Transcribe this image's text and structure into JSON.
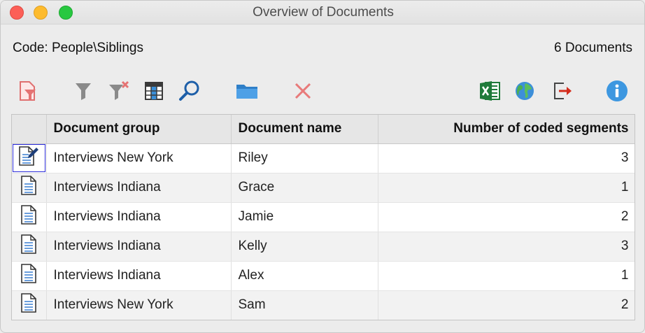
{
  "window": {
    "title": "Overview of Documents"
  },
  "header": {
    "code_label": "Code: People\\Siblings",
    "doc_count": "6 Documents"
  },
  "toolbar": {
    "icons": [
      "filter-document-icon",
      "funnel-icon",
      "funnel-clear-icon",
      "columns-icon",
      "search-icon",
      "folder-icon",
      "delete-icon",
      "excel-icon",
      "globe-icon",
      "export-icon",
      "info-icon"
    ]
  },
  "table": {
    "columns": [
      "Document group",
      "Document name",
      "Number of coded segments"
    ],
    "rows": [
      {
        "group": "Interviews New York",
        "name": "Riley",
        "segments": "3"
      },
      {
        "group": "Interviews Indiana",
        "name": "Grace",
        "segments": "1"
      },
      {
        "group": "Interviews Indiana",
        "name": "Jamie",
        "segments": "2"
      },
      {
        "group": "Interviews Indiana",
        "name": "Kelly",
        "segments": "3"
      },
      {
        "group": "Interviews Indiana",
        "name": "Alex",
        "segments": "1"
      },
      {
        "group": "Interviews New York",
        "name": "Sam",
        "segments": "2"
      }
    ]
  },
  "colors": {
    "accent_blue": "#2d8bd8",
    "excel_green": "#1f7a3a",
    "delete_red": "#e86d6d",
    "export_red": "#d42c1c"
  }
}
